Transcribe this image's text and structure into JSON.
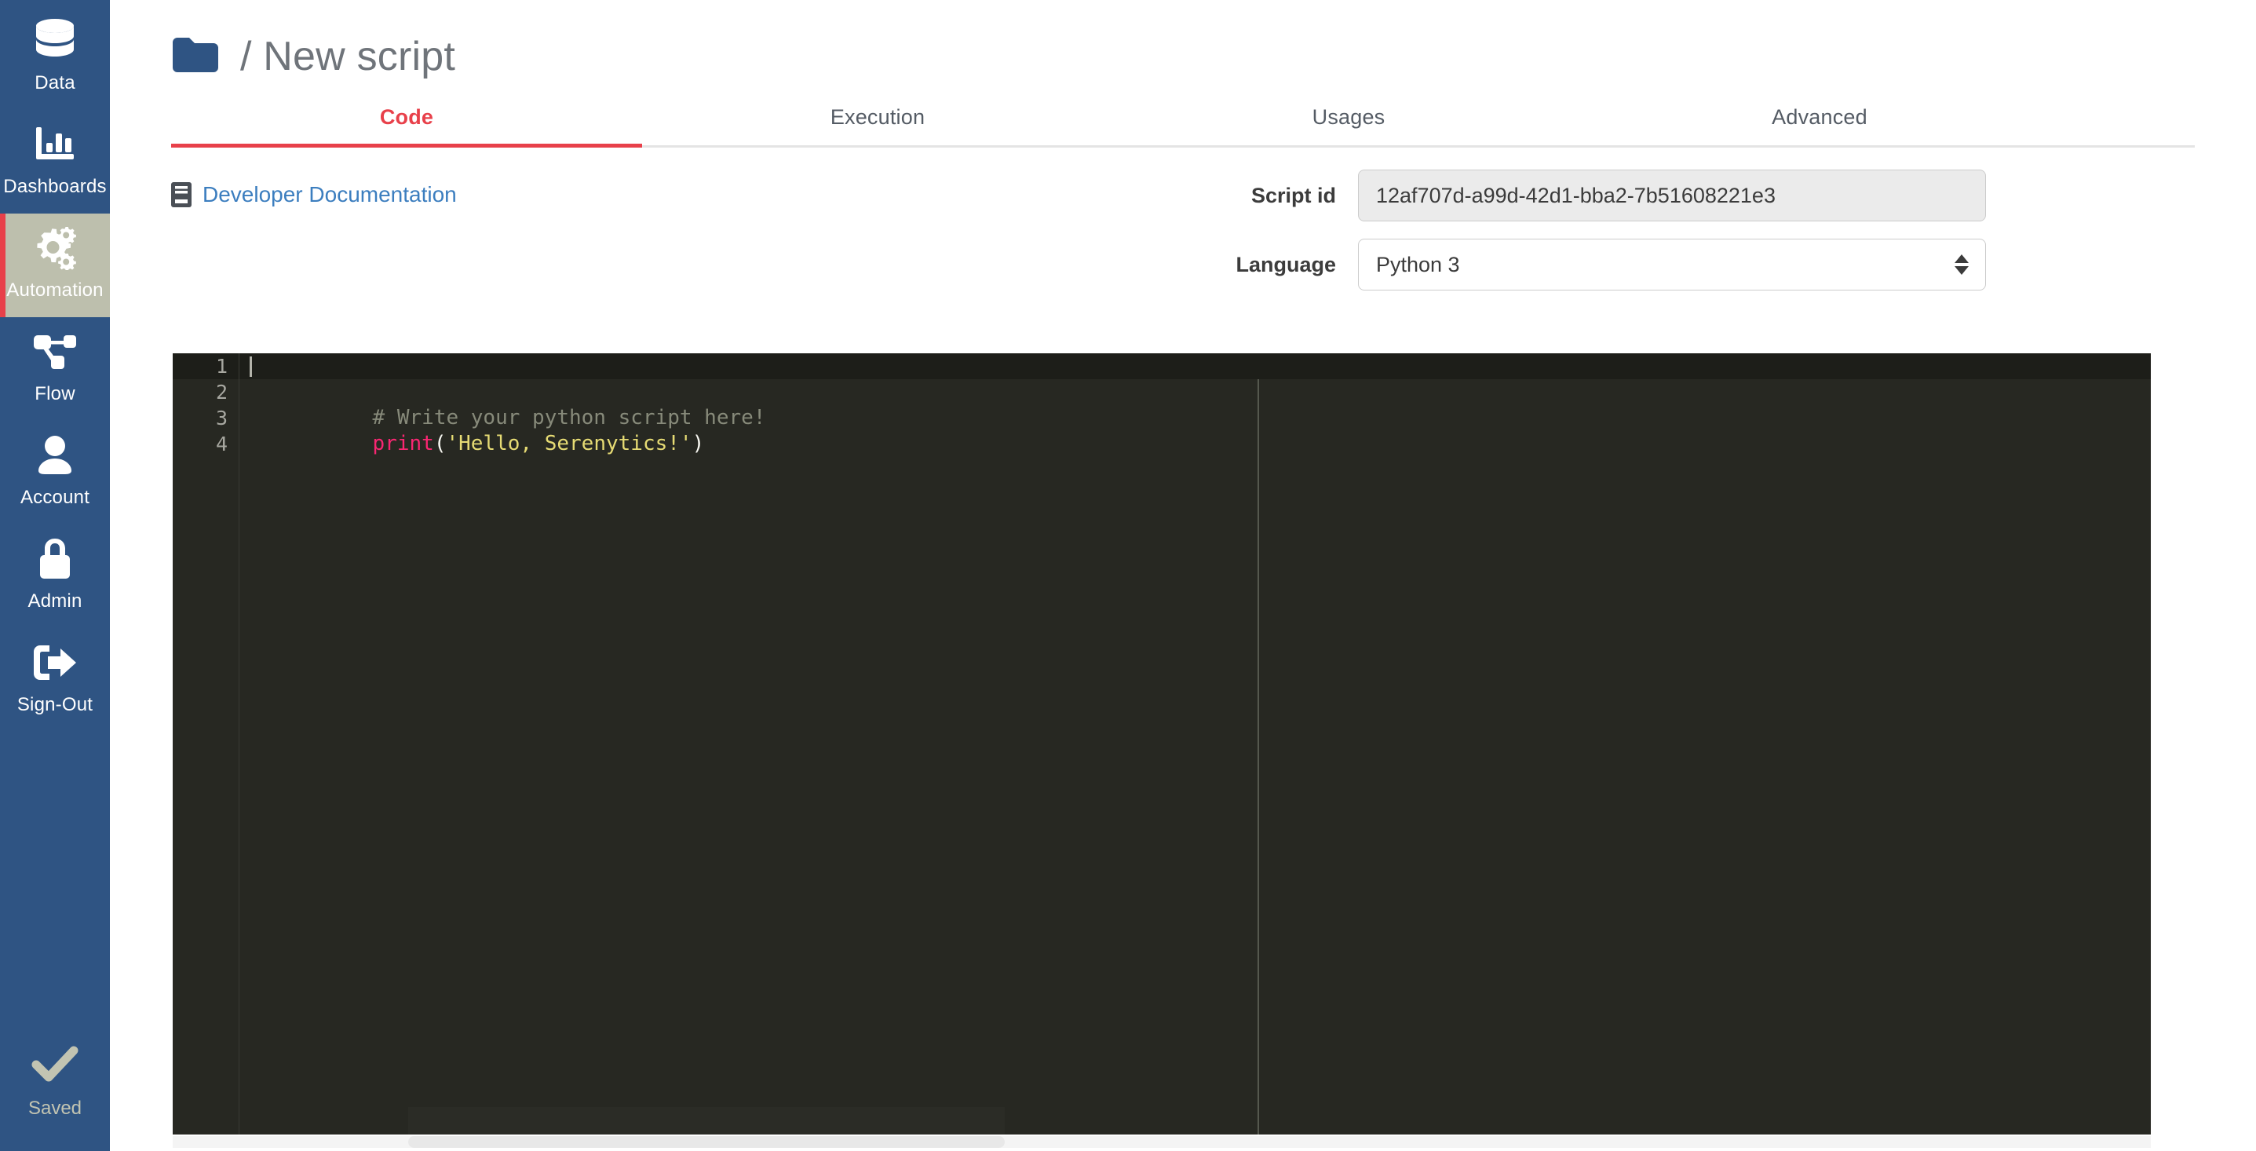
{
  "sidebar": {
    "background_color": "#2f5483",
    "active_background_color": "#bdbfad",
    "active_marker_color": "#e8404a",
    "items": [
      {
        "label": "Data",
        "icon": "database-icon",
        "active": false
      },
      {
        "label": "Dashboards",
        "icon": "bar-chart-icon",
        "active": false
      },
      {
        "label": "Automation",
        "icon": "gears-icon",
        "active": true
      },
      {
        "label": "Flow",
        "icon": "sitemap-icon",
        "active": false
      },
      {
        "label": "Account",
        "icon": "user-icon",
        "active": false
      },
      {
        "label": "Admin",
        "icon": "lock-icon",
        "active": false
      },
      {
        "label": "Sign-Out",
        "icon": "sign-out-icon",
        "active": false
      }
    ],
    "status": {
      "label": "Saved",
      "icon": "check-icon",
      "color": "#c2c4b2"
    }
  },
  "header": {
    "folder_icon": "folder-icon",
    "title": "/ New script",
    "title_color": "#6f747a"
  },
  "tabs": {
    "active_color": "#e8404a",
    "items": [
      {
        "label": "Code",
        "active": true
      },
      {
        "label": "Execution",
        "active": false
      },
      {
        "label": "Usages",
        "active": false
      },
      {
        "label": "Advanced",
        "active": false
      }
    ]
  },
  "doc_link": {
    "icon": "book-icon",
    "label": "Developer Documentation",
    "color": "#3c7ebf"
  },
  "form": {
    "script_id": {
      "label": "Script id",
      "value": "12af707d-a99d-42d1-bba2-7b51608221e3",
      "placeholder": "",
      "disabled": true
    },
    "language": {
      "label": "Language",
      "value": "Python 3",
      "options": [
        "Python 3"
      ]
    }
  },
  "editor": {
    "theme": "monokai",
    "background_color": "#272822",
    "active_line_color": "#1d1e19",
    "cursor_line": 1,
    "cursor_column": 1,
    "gutter": [
      "1",
      "2",
      "3",
      "4"
    ],
    "lines": [
      {
        "number": "1",
        "tokens": []
      },
      {
        "number": "2",
        "tokens": [
          {
            "type": "comment",
            "text": "# Write your python script here!"
          }
        ]
      },
      {
        "number": "3",
        "tokens": [
          {
            "type": "keyword",
            "text": "print"
          },
          {
            "type": "punct",
            "text": "("
          },
          {
            "type": "string",
            "text": "'Hello, Serenytics!'"
          },
          {
            "type": "punct",
            "text": ")"
          }
        ]
      },
      {
        "number": "4",
        "tokens": []
      }
    ]
  }
}
